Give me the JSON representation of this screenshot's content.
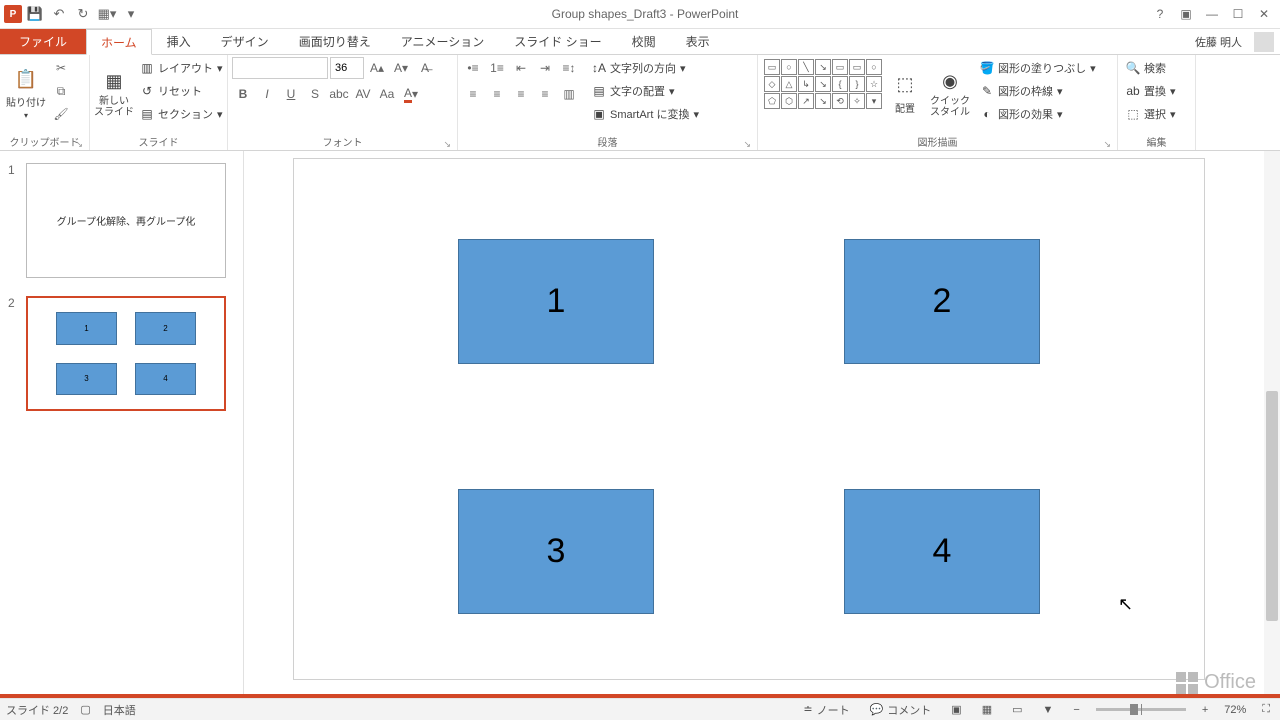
{
  "title": "Group shapes_Draft3 - PowerPoint",
  "user": "佐藤 明人",
  "tabs": {
    "file": "ファイル",
    "home": "ホーム",
    "insert": "挿入",
    "design": "デザイン",
    "transitions": "画面切り替え",
    "animations": "アニメーション",
    "slideshow": "スライド ショー",
    "review": "校閲",
    "view": "表示"
  },
  "ribbon": {
    "clipboard": {
      "label": "クリップボード",
      "paste": "貼り付け"
    },
    "slides": {
      "label": "スライド",
      "new": "新しい\nスライド",
      "layout": "レイアウト",
      "reset": "リセット",
      "section": "セクション"
    },
    "font": {
      "label": "フォント",
      "size": "36"
    },
    "paragraph": {
      "label": "段落",
      "textdir": "文字列の方向",
      "align": "文字の配置",
      "smartart": "SmartArt に変換"
    },
    "drawing": {
      "label": "図形描画",
      "arrange": "配置",
      "quickstyles": "クイック\nスタイル",
      "fill": "図形の塗りつぶし",
      "outline": "図形の枠線",
      "effects": "図形の効果"
    },
    "editing": {
      "label": "編集",
      "find": "検索",
      "replace": "置換",
      "select": "選択"
    }
  },
  "thumbs": {
    "n1": "1",
    "t1": "グループ化解除、再グループ化",
    "n2": "2"
  },
  "shapes": {
    "s1": "1",
    "s2": "2",
    "s3": "3",
    "s4": "4"
  },
  "office": "Office",
  "status": {
    "slide": "スライド 2/2",
    "lang": "日本語",
    "notes": "ノート",
    "comments": "コメント",
    "zoom": "72%"
  }
}
